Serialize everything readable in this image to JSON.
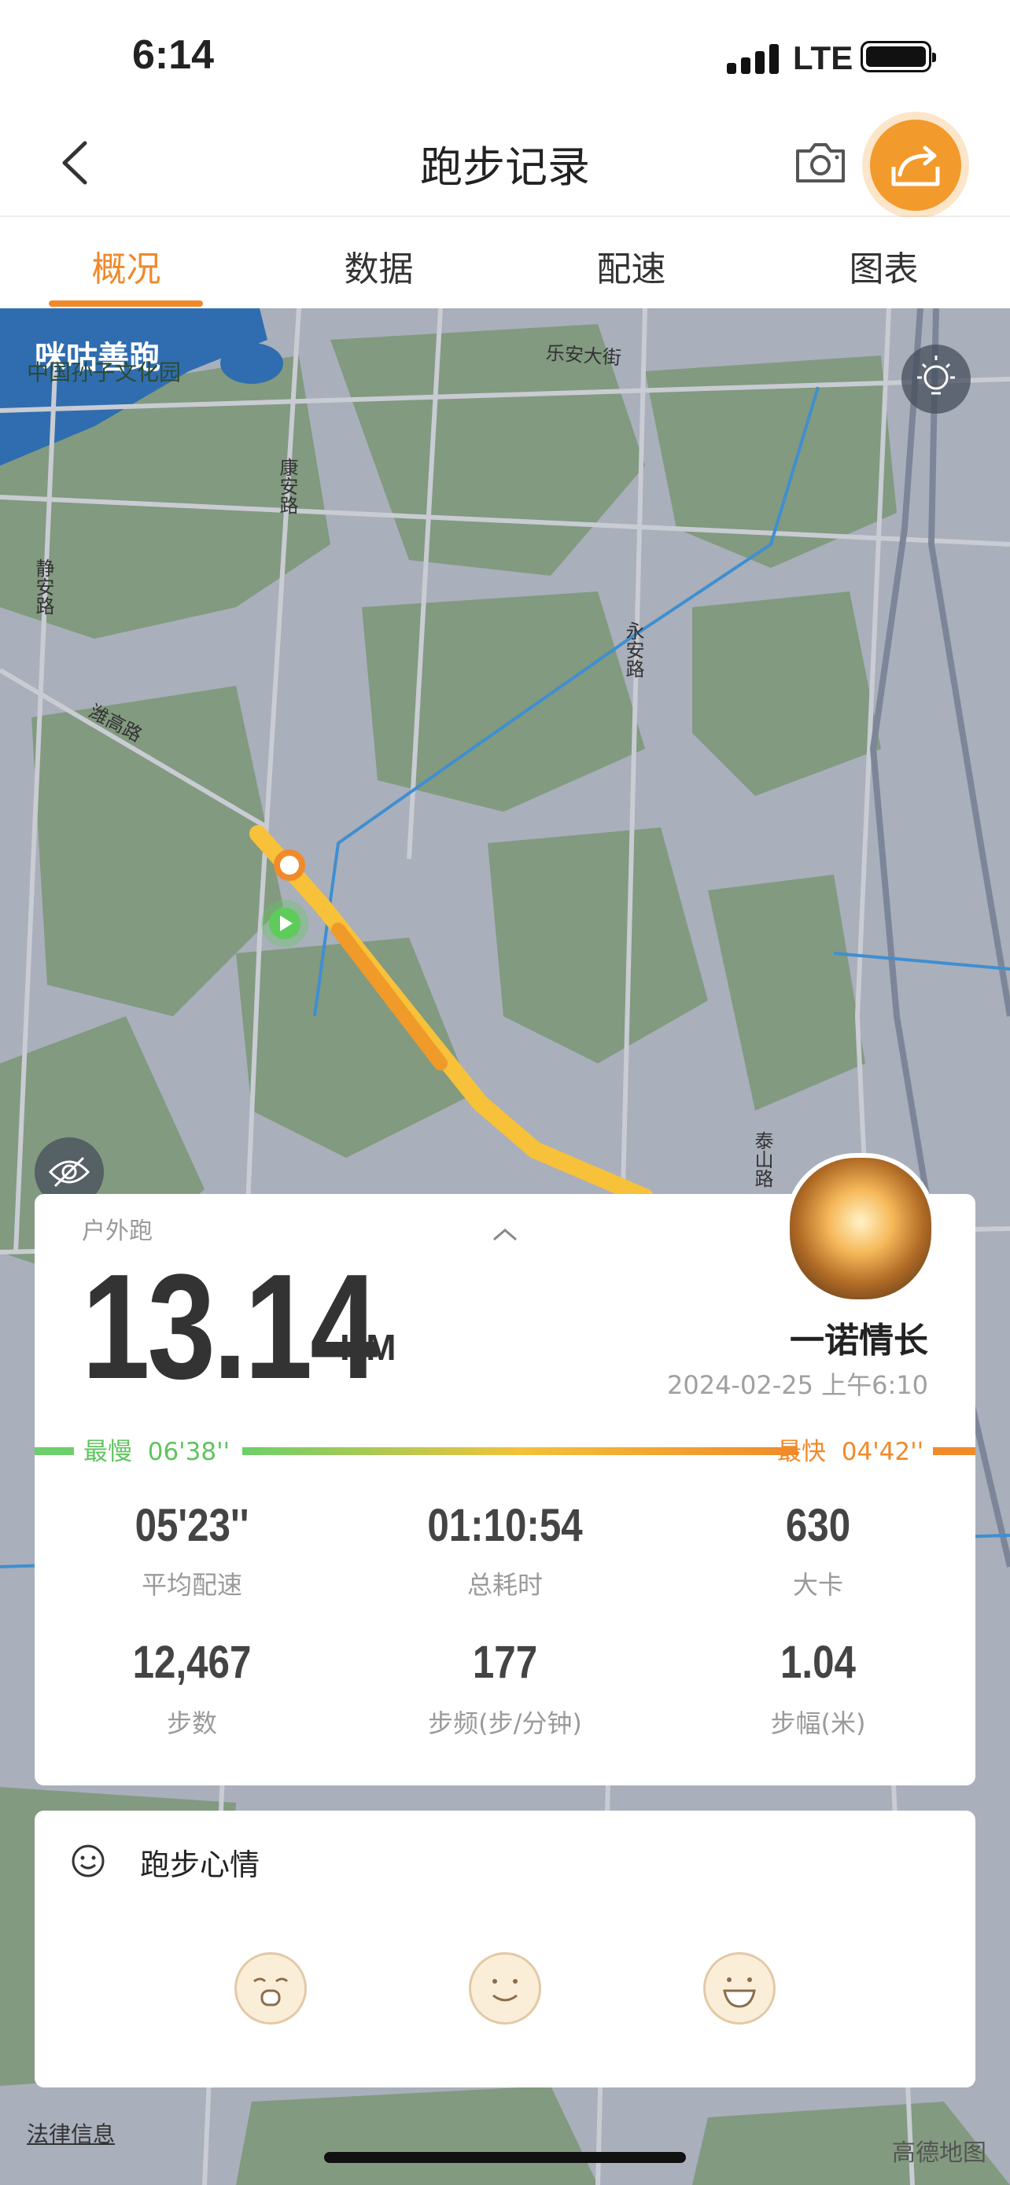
{
  "status_bar": {
    "time": "6:14",
    "network": "LTE"
  },
  "nav": {
    "title": "跑步记录"
  },
  "tabs": [
    {
      "label": "概况",
      "active": true
    },
    {
      "label": "数据",
      "active": false
    },
    {
      "label": "配速",
      "active": false
    },
    {
      "label": "图表",
      "active": false
    }
  ],
  "map": {
    "brand_logo": "咪咕善跑",
    "labels": {
      "park": "中国孙子文化园",
      "road1": "乐安大街",
      "road2": "康安路",
      "road3": "静安路",
      "road4": "潍高路",
      "road5": "永安路",
      "road6": "泰山路"
    },
    "legal": "法律信息",
    "provider": "高德地图"
  },
  "summary": {
    "run_type": "户外跑",
    "distance": "13.14",
    "unit": "KM",
    "username": "一诺情长",
    "datetime": "2024-02-25 上午6:10",
    "slowest_label": "最慢",
    "slowest_value": "06'38''",
    "fastest_label": "最快",
    "fastest_value": "04'42''",
    "stats": [
      {
        "value": "05'23''",
        "label": "平均配速"
      },
      {
        "value": "01:10:54",
        "label": "总耗时"
      },
      {
        "value": "630",
        "label": "大卡"
      },
      {
        "value": "12,467",
        "label": "步数"
      },
      {
        "value": "177",
        "label": "步频(步/分钟)"
      },
      {
        "value": "1.04",
        "label": "步幅(米)"
      }
    ]
  },
  "mood": {
    "title": "跑步心情"
  },
  "colors": {
    "accent": "#f0892a",
    "slow": "#6ccf6b",
    "fast": "#f08a2a"
  }
}
